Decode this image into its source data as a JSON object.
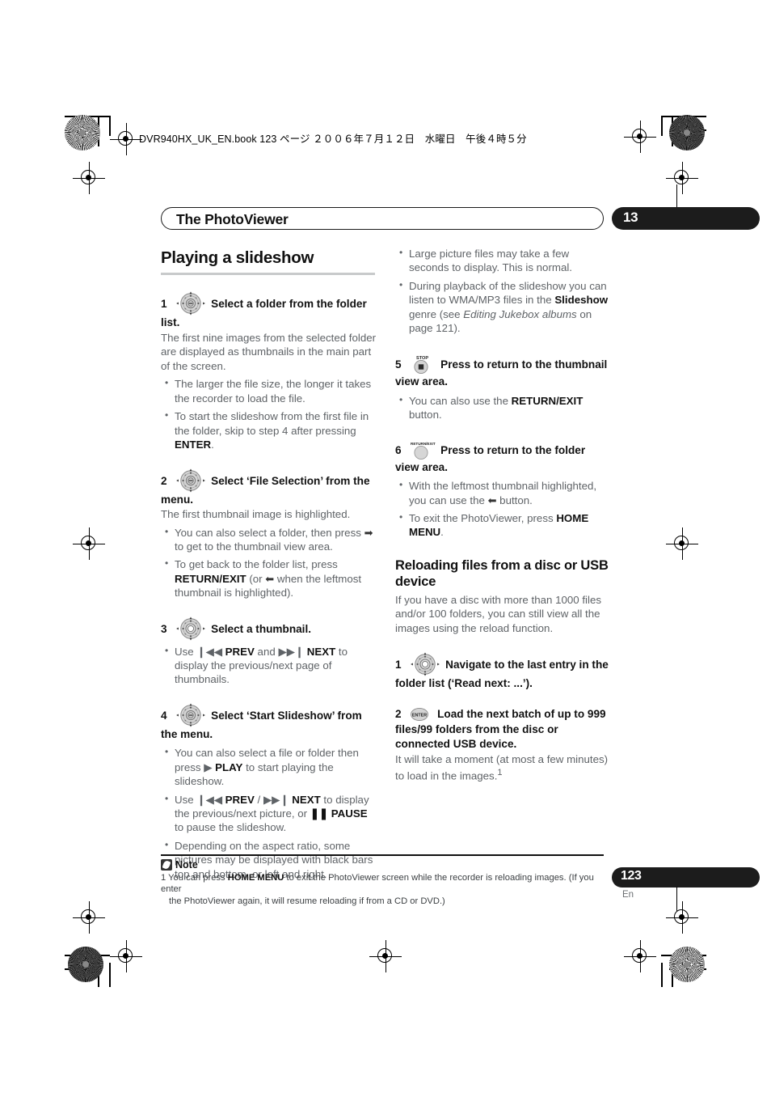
{
  "print_marks": {
    "file_line": "DVR940HX_UK_EN.book  123 ページ  ２００６年７月１２日　水曜日　午後４時５分"
  },
  "header": {
    "chapter_title": "The PhotoViewer",
    "chapter_number": "13"
  },
  "left_column": {
    "section_title": "Playing a slideshow",
    "steps": [
      {
        "num": "1",
        "icon": "dpad-enter-icon",
        "heading": "Select a folder from the folder list.",
        "follow": "The first nine images from the selected folder are displayed as thumbnails in the main part of the screen.",
        "bullets": [
          "The larger the file size, the longer it takes the recorder to load the file.",
          "To start the slideshow from the first file in the folder, skip to step 4 after pressing ENTER."
        ]
      },
      {
        "num": "2",
        "icon": "dpad-enter-icon",
        "heading": "Select ‘File Selection’ from the menu.",
        "follow": "The first thumbnail image is highlighted.",
        "bullets": [
          "You can also select a folder, then press ➡ to get to the thumbnail view area.",
          "To get back to the folder list, press RETURN/EXIT (or ⬅ when the leftmost thumbnail is highlighted)."
        ]
      },
      {
        "num": "3",
        "icon": "dpad-icon",
        "heading": "Select a thumbnail.",
        "follow": "",
        "bullets": [
          "Use ◀◀ PREV and ▶▶ NEXT to display the previous/next page of thumbnails."
        ]
      },
      {
        "num": "4",
        "icon": "dpad-enter-icon",
        "heading": "Select ‘Start Slideshow’ from the menu.",
        "follow": "",
        "bullets": [
          "You can also select a file or folder then press ▶ PLAY to start playing the slideshow.",
          "Use ◀◀ PREV / ▶▶ NEXT to display the previous/next picture, or ❚❚ PAUSE to pause the slideshow.",
          "Depending on the aspect ratio, some pictures may be displayed with black bars top and bottom, or left and right."
        ]
      }
    ]
  },
  "right_column": {
    "intro_bullets": [
      "Large picture files may take a few seconds to display. This is normal.",
      "During playback of the slideshow you can listen to WMA/MP3 files in the Slideshow genre (see Editing Jukebox albums on page 121)."
    ],
    "steps": [
      {
        "num": "5",
        "icon": "stop-button-icon",
        "icon_label": "STOP",
        "heading": "Press to return to the thumbnail view area.",
        "bullets": [
          "You can also use the RETURN/EXIT button."
        ]
      },
      {
        "num": "6",
        "icon": "return-exit-button-icon",
        "icon_label": "RETURN/EXIT",
        "heading": "Press to return to the folder view area.",
        "bullets": [
          "With the leftmost thumbnail highlighted, you can use the ⬅ button.",
          "To exit the PhotoViewer, press HOME MENU."
        ]
      }
    ],
    "subsection_title": "Reloading files from a disc or USB device",
    "subsection_body": "If you have a disc with more than 1000 files and/or 100 folders, you can still view all the images using the reload function.",
    "reload_steps": [
      {
        "num": "1",
        "icon": "dpad-icon",
        "heading": "Navigate to the last entry in the folder list (‘Read next: ...’).",
        "follow": ""
      },
      {
        "num": "2",
        "icon": "enter-button-icon",
        "icon_label": "ENTER",
        "heading": "Load the next batch of up to 999 files/99 folders from the disc or connected USB device.",
        "follow": "It will take a moment (at most a few minutes) to load in the images."
      }
    ]
  },
  "note": {
    "label": "Note",
    "icon": "note-pencil-icon",
    "line1_pre": "1 You can press ",
    "line1_bold": "HOME MENU",
    "line1_post": " to exit the PhotoViewer screen while the recorder is reloading images. (If you enter",
    "line2": "the PhotoViewer again, it will resume reloading if from a CD or DVD.)"
  },
  "footer": {
    "page_number": "123",
    "language": "En"
  },
  "colors": {
    "body_text": "#5f6367",
    "heading_text": "#111111",
    "pill_bg": "#1c1c1c",
    "rule": "#c8cacb"
  }
}
